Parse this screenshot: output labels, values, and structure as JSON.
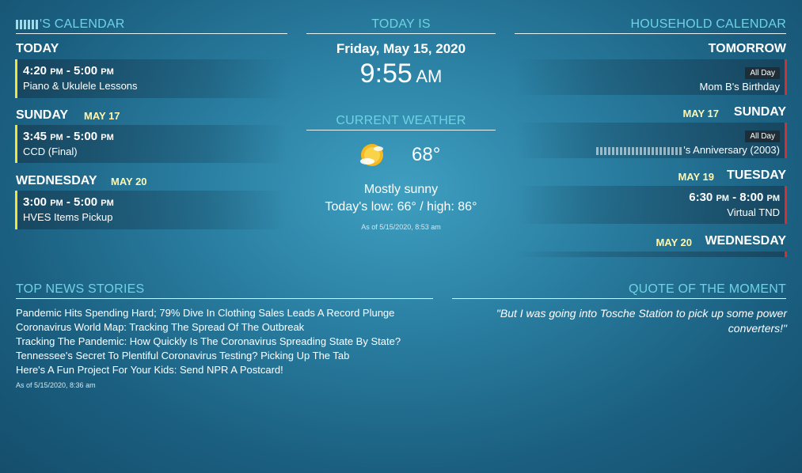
{
  "my_calendar": {
    "heading": "'S CALENDAR",
    "groups": [
      {
        "day": "TODAY",
        "date": "",
        "events": [
          {
            "start": "4:20",
            "start_ap": "PM",
            "end": "5:00",
            "end_ap": "PM",
            "name": "Piano & Ukulele Lessons"
          }
        ]
      },
      {
        "day": "SUNDAY",
        "date": "MAY 17",
        "events": [
          {
            "start": "3:45",
            "start_ap": "PM",
            "end": "5:00",
            "end_ap": "PM",
            "name": "CCD (Final)"
          }
        ]
      },
      {
        "day": "WEDNESDAY",
        "date": "MAY 20",
        "events": [
          {
            "start": "3:00",
            "start_ap": "PM",
            "end": "5:00",
            "end_ap": "PM",
            "name": "HVES Items Pickup"
          }
        ]
      }
    ]
  },
  "today": {
    "heading": "TODAY IS",
    "date": "Friday, May 15, 2020",
    "time": "9:55",
    "ampm": "AM"
  },
  "weather": {
    "heading": "CURRENT WEATHER",
    "icon": "partly-sunny-icon",
    "temp": "68°",
    "condition": "Mostly sunny",
    "lowhigh": "Today's low: 66° / high: 86°",
    "asof": "As of 5/15/2020, 8:53 am"
  },
  "household_calendar": {
    "heading": "HOUSEHOLD CALENDAR",
    "groups": [
      {
        "day": "TOMORROW",
        "date": "",
        "events": [
          {
            "allday": "All Day",
            "name": "Mom B's Birthday"
          }
        ]
      },
      {
        "day": "SUNDAY",
        "date": "MAY 17",
        "events": [
          {
            "allday": "All Day",
            "name": "'s Anniversary (2003)"
          }
        ]
      },
      {
        "day": "TUESDAY",
        "date": "MAY 19",
        "events": [
          {
            "start": "6:30",
            "start_ap": "PM",
            "end": "8:00",
            "end_ap": "PM",
            "name": "Virtual TND"
          }
        ]
      },
      {
        "day": "WEDNESDAY",
        "date": "MAY 20",
        "events": []
      }
    ]
  },
  "news": {
    "heading": "TOP NEWS STORIES",
    "items": [
      "Pandemic Hits Spending Hard; 79% Dive In Clothing Sales Leads A Record Plunge",
      "Coronavirus World Map: Tracking The Spread Of The Outbreak",
      "Tracking The Pandemic: How Quickly Is The Coronavirus Spreading State By State?",
      "Tennessee's Secret To Plentiful Coronavirus Testing? Picking Up The Tab",
      "Here's A Fun Project For Your Kids: Send NPR A Postcard!"
    ],
    "asof": "As of 5/15/2020, 8:36 am"
  },
  "quote": {
    "heading": "QUOTE OF THE MOMENT",
    "text": "\"But I was going into Tosche Station to pick up some power converters!\""
  },
  "colors": {
    "heading": "#6fd2e3",
    "date_accent": "#fff7b0",
    "left_bar": "#f3e23a",
    "right_bar": "#d43030"
  }
}
